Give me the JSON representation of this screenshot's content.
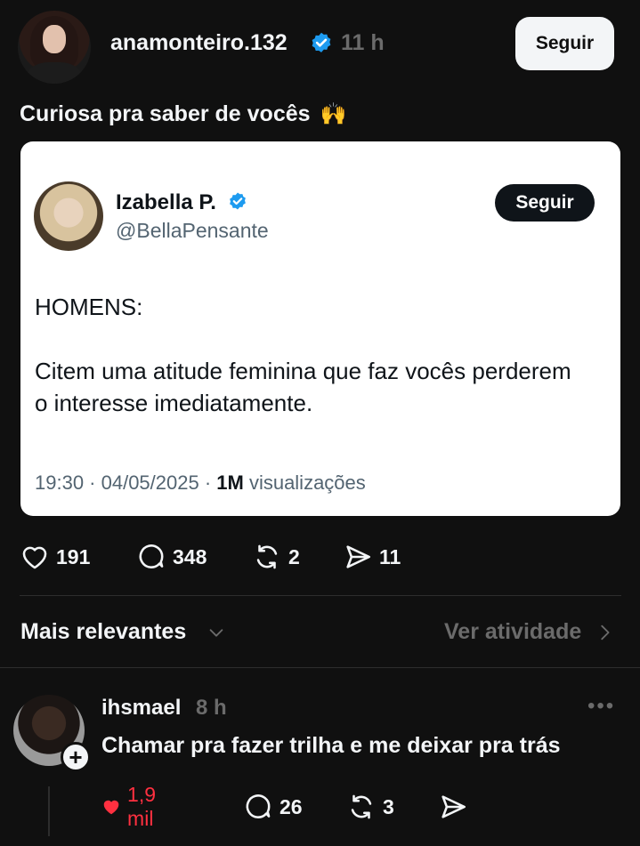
{
  "post": {
    "username": "anamonteiro.132",
    "time": "11 h",
    "follow_label": "Seguir",
    "caption": "Curiosa pra saber de vocês",
    "caption_emoji": "🙌"
  },
  "tweet": {
    "name": "Izabella P.",
    "handle": "@BellaPensante",
    "follow_label": "Seguir",
    "body_line1": "HOMENS:",
    "body_line2": "Citem uma atitude feminina que faz vocês perderem o interesse imediatamente.",
    "time": "19:30 · 04/05/2025 · ",
    "views_count": "1M",
    "views_label": " visualizações"
  },
  "actions": {
    "likes": "191",
    "replies": "348",
    "reposts": "2",
    "shares": "11"
  },
  "sort": {
    "label": "Mais relevantes",
    "activity": "Ver atividade"
  },
  "comment": {
    "username": "ihsmael",
    "time": "8 h",
    "more": "•••",
    "text": "Chamar pra fazer trilha e me deixar pra trás",
    "plus": "+",
    "likes": "1,9 mil",
    "replies": "26",
    "reposts": "3"
  },
  "colors": {
    "background": "#101010",
    "text": "#f3f5f7",
    "muted": "#6b6b6b",
    "verified": "#1d9bf0",
    "liked": "#ff3040"
  },
  "icons": [
    "verified-badge-icon",
    "heart-icon",
    "comment-icon",
    "repost-icon",
    "share-icon",
    "chevron-down-icon",
    "chevron-right-icon",
    "more-icon",
    "plus-icon"
  ]
}
